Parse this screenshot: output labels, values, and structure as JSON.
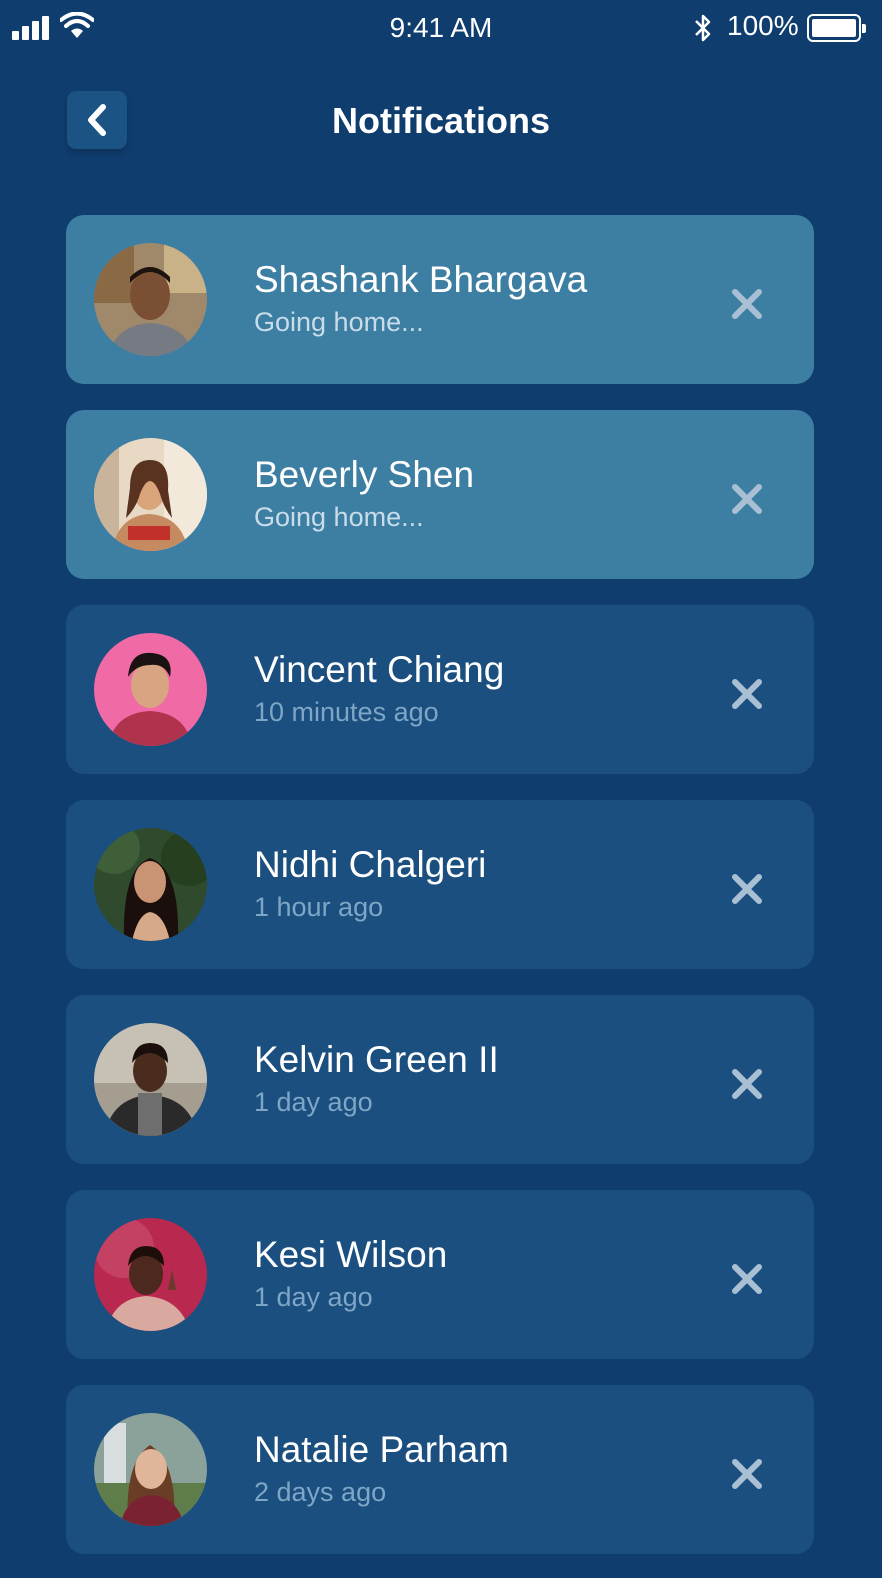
{
  "status_bar": {
    "time": "9:41 AM",
    "battery_percent": "100%",
    "icons": [
      "signal-icon",
      "wifi-icon",
      "bluetooth-icon",
      "battery-icon"
    ]
  },
  "header": {
    "title": "Notifications",
    "back_icon": "chevron-left-icon"
  },
  "colors": {
    "background": "#0f3d6e",
    "card": "#1b4f7f",
    "card_highlight": "#3d7ea3",
    "subtitle": "#7ea6c6",
    "close_icon": "#a9c0d4"
  },
  "notifications": [
    {
      "name": "Shashank Bhargava",
      "subtitle": "Going home...",
      "highlighted": true,
      "avatar": "avatar-photo"
    },
    {
      "name": "Beverly Shen",
      "subtitle": "Going home...",
      "highlighted": true,
      "avatar": "avatar-photo"
    },
    {
      "name": "Vincent Chiang",
      "subtitle": "10 minutes ago",
      "highlighted": false,
      "avatar": "avatar-photo"
    },
    {
      "name": "Nidhi Chalgeri",
      "subtitle": "1 hour ago",
      "highlighted": false,
      "avatar": "avatar-photo"
    },
    {
      "name": "Kelvin Green II",
      "subtitle": "1 day ago",
      "highlighted": false,
      "avatar": "avatar-photo"
    },
    {
      "name": "Kesi Wilson",
      "subtitle": "1 day ago",
      "highlighted": false,
      "avatar": "avatar-photo"
    },
    {
      "name": "Natalie Parham",
      "subtitle": "2 days ago",
      "highlighted": false,
      "avatar": "avatar-photo"
    }
  ]
}
